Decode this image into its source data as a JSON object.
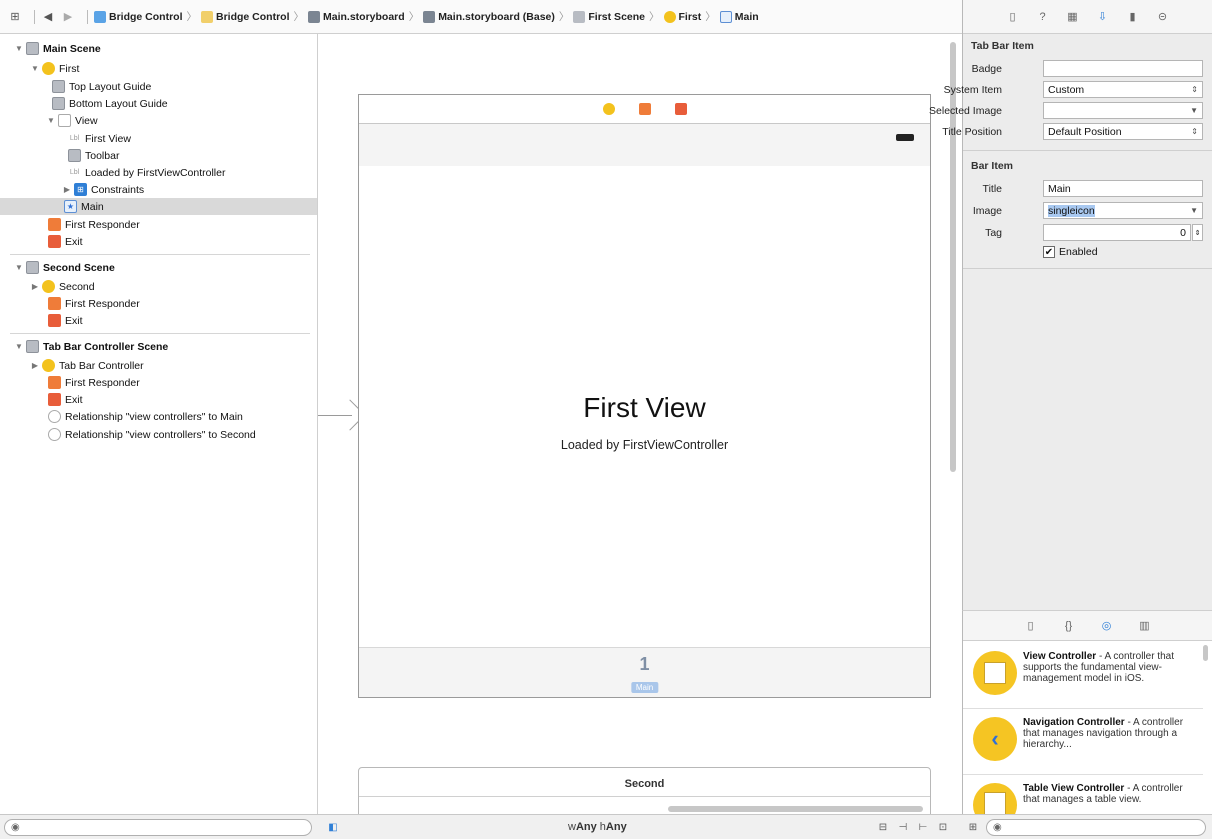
{
  "breadcrumbs": [
    "Bridge Control",
    "Bridge Control",
    "Main.storyboard",
    "Main.storyboard (Base)",
    "First Scene",
    "First",
    "Main"
  ],
  "outline": {
    "main_scene": "Main Scene",
    "first": "First",
    "top_layout_guide": "Top Layout Guide",
    "bottom_layout_guide": "Bottom Layout Guide",
    "view": "View",
    "first_view_label": "First View",
    "toolbar": "Toolbar",
    "loaded_label": "Loaded by FirstViewController",
    "constraints": "Constraints",
    "main": "Main",
    "first_responder": "First Responder",
    "exit": "Exit",
    "second_scene": "Second Scene",
    "second": "Second",
    "second_first_responder": "First Responder",
    "second_exit": "Exit",
    "tab_scene": "Tab Bar Controller Scene",
    "tab_bar_controller": "Tab Bar Controller",
    "tab_first_responder": "First Responder",
    "tab_exit": "Exit",
    "rel_main": "Relationship \"view controllers\" to Main",
    "rel_second": "Relationship \"view controllers\" to Second"
  },
  "canvas": {
    "first_view_title": "First View",
    "first_view_subtitle": "Loaded by FirstViewController",
    "tab_badge": "1",
    "tab_label": "Main",
    "second_scene_title": "Second"
  },
  "inspector": {
    "tab_bar_item_header": "Tab Bar Item",
    "badge_label": "Badge",
    "badge_value": "",
    "system_item_label": "System Item",
    "system_item_value": "Custom",
    "selected_image_label": "Selected Image",
    "selected_image_value": "",
    "title_position_label": "Title Position",
    "title_position_value": "Default Position",
    "bar_item_header": "Bar Item",
    "title_label": "Title",
    "title_value": "Main",
    "image_label": "Image",
    "image_value": "singleicon",
    "tag_label": "Tag",
    "tag_value": "0",
    "enabled_label": "Enabled"
  },
  "library": {
    "items": [
      {
        "name": "View Controller",
        "desc": " - A controller that supports the fundamental view-management model in iOS."
      },
      {
        "name": "Navigation Controller",
        "desc": " - A controller that manages navigation through a hierarchy..."
      },
      {
        "name": "Table View Controller",
        "desc": " - A controller that manages a table view."
      }
    ]
  },
  "bottombar": {
    "size_w_prefix": "w",
    "size_w": "Any",
    "size_h_prefix": " h",
    "size_h": "Any"
  },
  "icons": {
    "scene": "scene-icon",
    "view_controller": "view-controller-icon",
    "first_responder": "first-responder-icon",
    "exit": "exit-icon",
    "tab_bar_item": "star-icon"
  },
  "colors": {
    "yellow": "#f3c21d",
    "orange": "#ef7c39",
    "red": "#e85d3a",
    "blue": "#2f7fd6",
    "selection": "#d9d9d9"
  }
}
